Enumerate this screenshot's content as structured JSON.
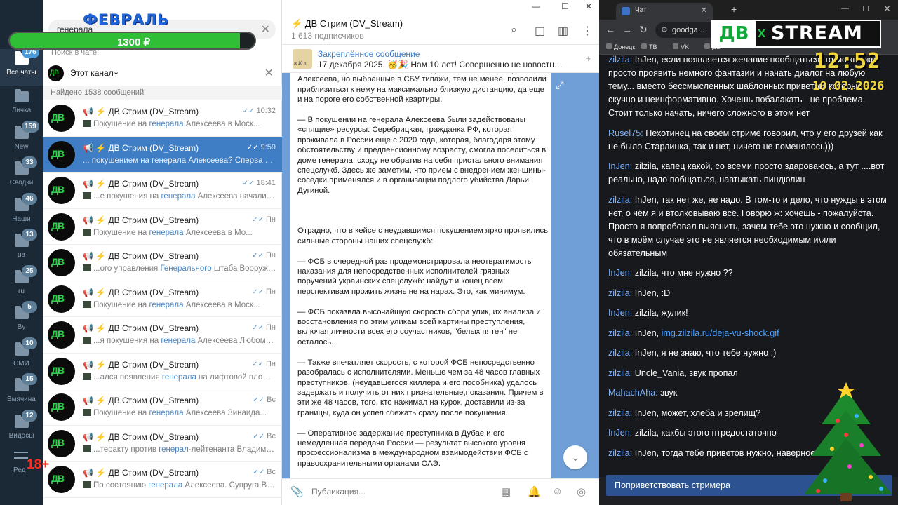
{
  "rail": {
    "items": [
      {
        "label": "Все чаты",
        "badge": "176",
        "active": true
      },
      {
        "label": "Личка",
        "badge": ""
      },
      {
        "label": "New",
        "badge": "159"
      },
      {
        "label": "Сводки",
        "badge": "33"
      },
      {
        "label": "Наши",
        "badge": "46"
      },
      {
        "label": "ua",
        "badge": "13"
      },
      {
        "label": "ru",
        "badge": "25"
      },
      {
        "label": "By",
        "badge": "5"
      },
      {
        "label": "СМИ",
        "badge": "10"
      },
      {
        "label": "Вмячина",
        "badge": "15"
      },
      {
        "label": "Видосы",
        "badge": "12"
      }
    ],
    "edit_label": "Ред",
    "age_label": "18+"
  },
  "overlay": {
    "month": "ФЕВРАЛЬ",
    "price": "1300 ₽",
    "price_fill": 0.94,
    "logo_db": "ДВ",
    "logo_x": "x",
    "logo_stream": "STREAM",
    "clock_time": "12:52",
    "clock_date": "10.02.2026"
  },
  "search": {
    "value": "генерала",
    "in_chat_label": "Поиск в чате:",
    "channel_filter": "Этот канал",
    "found": "Найдено 1538 сообщений"
  },
  "results": [
    {
      "name": "📢 ⚡ ДВ Стрим (DV_Stream)",
      "time": "10:32",
      "pre": "Покушение на ",
      "hl": "генерала",
      "post": " Алексеева в Моск..."
    },
    {
      "name": "📢 ⚡ ДВ Стрим (DV_Stream)",
      "time": "9:59",
      "pre": "... покушением на генерала Алексеева?   Сперва на...",
      "hl": "",
      "post": "",
      "selected": true
    },
    {
      "name": "📢 ⚡ ДВ Стрим (DV_Stream)",
      "time": "18:41",
      "pre": "...е покушения на ",
      "hl": "генерала",
      "post": " Алексеева начались..."
    },
    {
      "name": "📢 ⚡ ДВ Стрим (DV_Stream)",
      "time": "Пн",
      "pre": "Покушение на ",
      "hl": "генерала",
      "post": " Алексеева в Мо..."
    },
    {
      "name": "📢 ⚡ ДВ Стрим (DV_Stream)",
      "time": "Пн",
      "pre": "...ого управления ",
      "hl": "Генерального",
      "post": " штаба Вооруже..."
    },
    {
      "name": "📢 ⚡ ДВ Стрим (DV_Stream)",
      "time": "Пн",
      "pre": "Покушение на ",
      "hl": "генерала",
      "post": " Алексеева в Моск..."
    },
    {
      "name": "📢 ⚡ ДВ Стрим (DV_Stream)",
      "time": "Пн",
      "pre": "...я покушения на ",
      "hl": "генерала",
      "post": " Алексеева Любомир..."
    },
    {
      "name": "📢 ⚡ ДВ Стрим (DV_Stream)",
      "time": "Пн",
      "pre": "...ался появления ",
      "hl": "генерала",
      "post": " на лифтовой площадке..."
    },
    {
      "name": "📢 ⚡ ДВ Стрим (DV_Stream)",
      "time": "Вс",
      "pre": "Покушение на ",
      "hl": "генерала",
      "post": " Алексеева Зинаида..."
    },
    {
      "name": "📢 ⚡ ДВ Стрим (DV_Stream)",
      "time": "Вс",
      "pre": "...теракту против ",
      "hl": "генерал",
      "post": "-лейтенанта Владимира А..."
    },
    {
      "name": "📢 ⚡ ДВ Стрим (DV_Stream)",
      "time": "Вс",
      "pre": "По состоянию ",
      "hl": "генерала",
      "post": " Алексеева.  Супруга Влади..."
    }
  ],
  "chat": {
    "title": "⚡ ДВ Стрим (DV_Stream)",
    "subscribers": "1 613 подписчиков",
    "pinned_title": "Закреплённое сообщение",
    "pinned_text": "17 декабря 2025. 🥳🎉 Нам 10 лет! Совершенно не новостный, н...",
    "pinned_thumb_caption": "ж 10 л",
    "composer_placeholder": "Публикация...",
    "message": [
      "только из-за решительных и четких действий самого генерала Алексеева, но выбранные в СБУ типажи, тем не менее, позволили приблизиться к нему на максимально близкую дистанцию, да еще и на пороге его собственной квартиры.",
      "— В покушении на генерала Алексеева были задействованы «спящие» ресурсы: Серебрицкая, гражданка РФ,  которая проживала в России еще с 2020 года, которая, благодаря этому обстоятельству и предпенсионному возрасту, смогла поселиться в доме генерала, сходу не обратив на себя пристального внимания спецслужб. Здесь же заметим, что прием с внедрением женщины-соседки применялся и в организации подлого убийства Дарьи Дугиной.",
      "",
      "Отрадно, что в кейсе с неудавшимся покушением ярко проявились сильные стороны наших спецслужб:",
      "— ФСБ в очередной раз продемонстрировала неотвратимость наказания для непосредственных исполнителей грязных поручений украинских спецслужб: найдут и конец всем перспективам прожить жизнь не на нарах. Это, как минимум.",
      "— ФСБ показвла высочайшую скорость сбора улик, их анализа и восстановления по этим уликам всей картины преступления, включая личности всех его соучастников, \"белых пятен\" не осталось.",
      "— Также впечатляет скорость, с которой ФСБ непосредственно разобралась с исполнителями. Меньше чем за 48 часов главных преступников, (неудавшегося киллера и его пособника) удалось задержать и получить от них признательные,показания. Причем в эти же 48 часов, того, кто нажимал на курок, доставили из-за границы, куда он успел сбежать сразу после покушения.",
      "—  Оперативное задержание преступника в Дубае и его немедленная передача России — результат высокого уровня профессионализма в международном взаимодействии ФСБ с правоохранительными органами ОАЭ."
    ]
  },
  "browser": {
    "tab_title": "Чат",
    "address": "goodga...",
    "bookmarks": [
      "Донецк",
      "ТВ",
      "VK",
      "ДВ"
    ],
    "greet_button": "Поприветствовать стримера"
  },
  "stream_chat": [
    {
      "user": "zilzila",
      "text": "InJen, если появляется желание пообщаться, то можно же просто проявить немного фантазии и начать диалог на любую тему... вместо бессмысленных шаблонных приветов, которые скучно и неинформативно. Хочешь побалакать - не проблема. Стоит только начать, ничего сложного в этом нет",
      "color": "blue"
    },
    {
      "user": "Rusel75",
      "text": "Пехотинец на своём стриме говорил, что у его друзей как не было Старлинка, так и нет, ничего не поменялось)))",
      "color": "blue"
    },
    {
      "user": "InJen",
      "text": "zilzila, капец какой, со всеми просто здароваюсь, а тут ....вот реально, надо побщаться, навтыкать пиндюлин",
      "color": "blue"
    },
    {
      "user": "zilzila",
      "text": "InJen, так нет же, не надо. В том-то и дело, что нужды в этом нет, о чём я и втолковываю всё. Говорю ж: хочешь - пожалуйста. Просто я попробовал выяснить, зачем тебе это нужно и сообщил, что в моём случае это не является необходимым и\\или обязательным",
      "color": "blue"
    },
    {
      "user": "InJen",
      "text": "zilzila, что мне нужно ??",
      "color": "blue"
    },
    {
      "user": "zilzila",
      "text": "InJen, :D",
      "color": "blue"
    },
    {
      "user": "InJen",
      "text": "zilzila, жулик!",
      "color": "blue"
    },
    {
      "user": "zilzila",
      "text": "InJen, ",
      "link": "img.zilzila.ru/deja-vu-shock.gif",
      "color": "blue"
    },
    {
      "user": "zilzila",
      "text": "InJen, я не знаю, что тебе нужно :)",
      "color": "blue"
    },
    {
      "user": "zilzila",
      "text": "Uncle_Vania, звук пропал",
      "color": "blue"
    },
    {
      "user": "MahachAha",
      "text": "звук",
      "color": "blue"
    },
    {
      "user": "zilzila",
      "text": "InJen, может, хлеба и зрелищ?",
      "color": "blue"
    },
    {
      "user": "InJen",
      "text": "zilzila, какбы этого птредостаточно",
      "color": "blue"
    },
    {
      "user": "zilzila",
      "text": "InJen, тогда тебе приветов нужно, наверное",
      "color": "blue"
    }
  ],
  "colors": {
    "rail": "#1b2836",
    "selected": "#3f7dc4",
    "chat_bg": "#6f9fd6",
    "username": "#7fb4ff"
  }
}
